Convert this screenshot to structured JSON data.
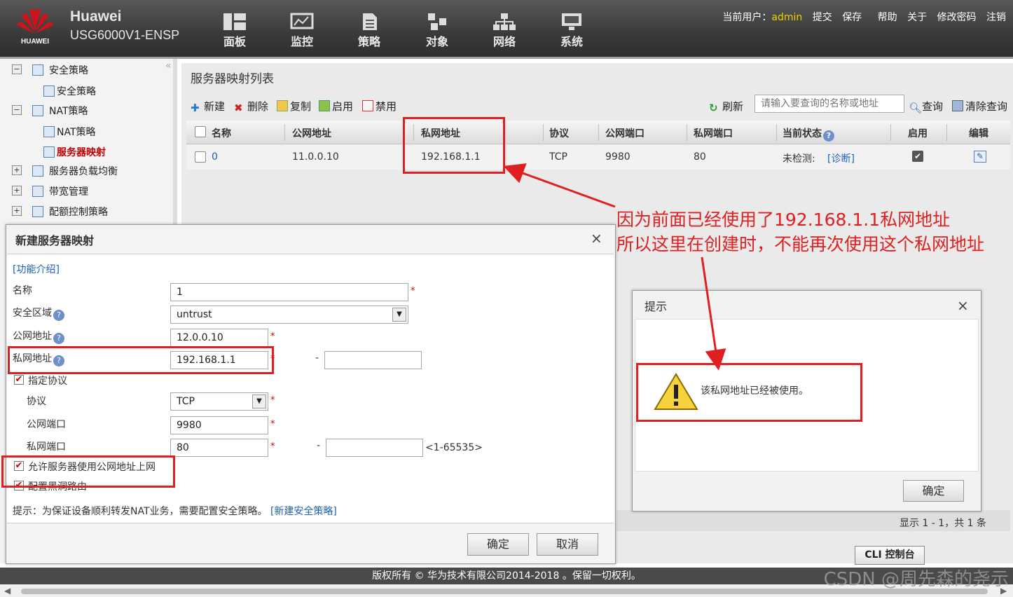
{
  "header": {
    "brand": "Huawei",
    "model": "USG6000V1-ENSP",
    "logo_text": "HUAWEI",
    "nav": [
      {
        "label": "面板",
        "icon": "dashboard-icon"
      },
      {
        "label": "监控",
        "icon": "monitor-icon"
      },
      {
        "label": "策略",
        "icon": "policy-icon"
      },
      {
        "label": "对象",
        "icon": "object-icon"
      },
      {
        "label": "网络",
        "icon": "network-icon"
      },
      {
        "label": "系统",
        "icon": "system-icon"
      }
    ],
    "user_label": "当前用户：",
    "user": "admin",
    "links": [
      "提交",
      "保存",
      "帮助",
      "关于",
      "修改密码",
      "注销"
    ]
  },
  "sidebar": {
    "collapse": "«",
    "items": [
      {
        "label": "安全策略",
        "box": "−"
      },
      {
        "label": "安全策略"
      },
      {
        "label": "NAT策略",
        "box": "−"
      },
      {
        "label": "NAT策略"
      },
      {
        "label": "服务器映射"
      },
      {
        "label": "服务器负载均衡",
        "box": "+"
      },
      {
        "label": "带宽管理",
        "box": "+"
      },
      {
        "label": "配额控制策略",
        "box": "+"
      }
    ]
  },
  "list": {
    "title": "服务器映射列表",
    "toolbar": {
      "new": "新建",
      "delete": "删除",
      "copy": "复制",
      "enable": "启用",
      "disable": "禁用",
      "refresh": "刷新",
      "search_placeholder": "请输入要查询的名称或地址",
      "query": "查询",
      "clear": "清除查询"
    },
    "columns": [
      "名称",
      "公网地址",
      "私网地址",
      "协议",
      "公网端口",
      "私网端口",
      "当前状态",
      "启用",
      "编辑"
    ],
    "row": {
      "name": "0",
      "public_ip": "11.0.0.10",
      "private_ip": "192.168.1.1",
      "protocol": "TCP",
      "public_port": "9980",
      "private_port": "80",
      "status": "未检测:",
      "diag": "[诊断]"
    },
    "footer": "显示 1 - 1，共 1 条"
  },
  "dialog": {
    "title": "新建服务器映射",
    "intro": "[功能介绍]",
    "name_label": "名称",
    "name_value": "1",
    "zone_label": "安全区域",
    "zone_value": "untrust",
    "public_label": "公网地址",
    "public_value": "12.0.0.10",
    "private_label": "私网地址",
    "private_value": "192.168.1.1",
    "spec_protocol": "指定协议",
    "protocol_label": "协议",
    "protocol_value": "TCP",
    "pub_port_label": "公网端口",
    "pub_port_value": "9980",
    "priv_port_label": "私网端口",
    "priv_port_value": "80",
    "range": "<1-65535>",
    "allow_internet": "允许服务器使用公网地址上网",
    "blackhole": "配置黑洞路由",
    "hint": "提示：为保证设备顺利转发NAT业务，需要配置安全策略。",
    "hint_link": "[新建安全策略]",
    "ok": "确定",
    "cancel": "取消",
    "dash": "-",
    "star": "*",
    "help": "?"
  },
  "alert": {
    "title": "提示",
    "message": "该私网地址已经被使用。",
    "ok": "确定"
  },
  "annotation": {
    "line1": "因为前面已经使用了192.168.1.1私网地址",
    "line2": "所以这里在创建时，不能再次使用这个私网地址",
    "color": "#e02020"
  },
  "cli": "CLI 控制台",
  "copyright": "版权所有 © 华为技术有限公司2014-2018 。保留一切权利。",
  "watermark": "CSDN @周先森的尧示",
  "close": "×"
}
